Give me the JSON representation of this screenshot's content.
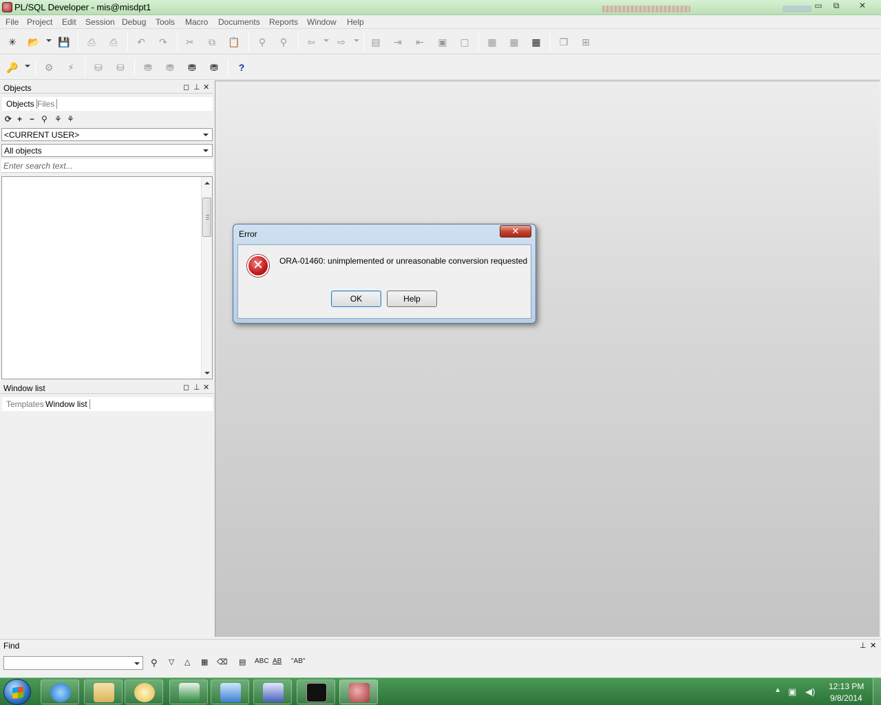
{
  "window": {
    "title": "PL/SQL Developer - mis@misdpt1",
    "controls": {
      "minimize": "▭",
      "maximize": "⧉",
      "close": "✕"
    }
  },
  "menubar": {
    "items": [
      "File",
      "Project",
      "Edit",
      "Session",
      "Debug",
      "Tools",
      "Macro",
      "Documents",
      "Reports",
      "Window",
      "Help"
    ]
  },
  "toolbar2": {
    "help_glyph": "?"
  },
  "objects_panel": {
    "title": "Objects",
    "tabs": [
      "Objects",
      "Files"
    ],
    "user_select": {
      "value": "<CURRENT USER>"
    },
    "type_select": {
      "value": "All objects"
    },
    "search": {
      "placeholder": "Enter search text..."
    }
  },
  "window_list_panel": {
    "title": "Window list",
    "tabs": [
      "Templates",
      "Window list"
    ]
  },
  "find_bar": {
    "title": "Find",
    "buttons": [
      "ABC",
      "AB",
      "\"AB\""
    ]
  },
  "dialog": {
    "title": "Error",
    "message": "ORA-01460: unimplemented or unreasonable conversion requested",
    "ok_label": "OK",
    "help_label": "Help"
  },
  "taskbar": {
    "clock_time": "12:13 PM",
    "clock_date": "9/8/2014"
  },
  "icons": {
    "error": "error-icon",
    "start": "windows-start-icon"
  }
}
